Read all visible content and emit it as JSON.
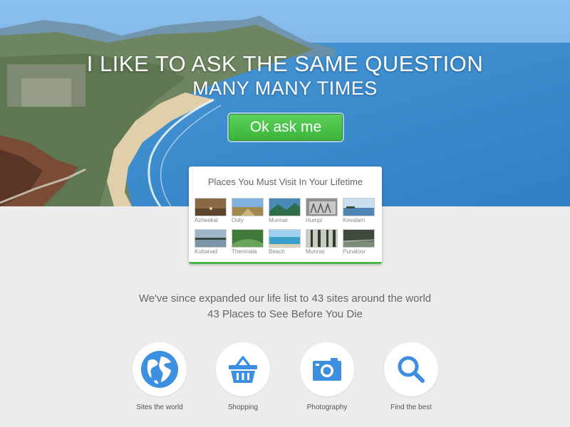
{
  "hero": {
    "headline": "I LIKE TO ASK THE SAME QUESTION",
    "subheadline": "MANY MANY TIMES",
    "cta_label": "Ok ask me",
    "cta_color": "#46b744"
  },
  "places_card": {
    "title": "Places You Must Visit In Your Lifetime",
    "items": [
      {
        "label": "Azheekal"
      },
      {
        "label": "Ooty"
      },
      {
        "label": "Munnar"
      },
      {
        "label": "Humpi"
      },
      {
        "label": "Kovalam"
      },
      {
        "label": "Kuttanad"
      },
      {
        "label": "Thenmala"
      },
      {
        "label": "Beach"
      },
      {
        "label": "Munnar"
      },
      {
        "label": "Punaloor"
      }
    ]
  },
  "info": {
    "line1": "We've since expanded our life list to 43 sites around the world",
    "line2": "43 Places to See Before You Die"
  },
  "features": [
    {
      "label": "Sites the world",
      "icon": "globe-icon"
    },
    {
      "label": "Shopping",
      "icon": "basket-icon"
    },
    {
      "label": "Photography",
      "icon": "camera-icon"
    },
    {
      "label": "Find the best",
      "icon": "search-icon"
    }
  ],
  "colors": {
    "accent_blue": "#3d8fe0",
    "accent_green": "#46b744",
    "background": "#ececec"
  }
}
